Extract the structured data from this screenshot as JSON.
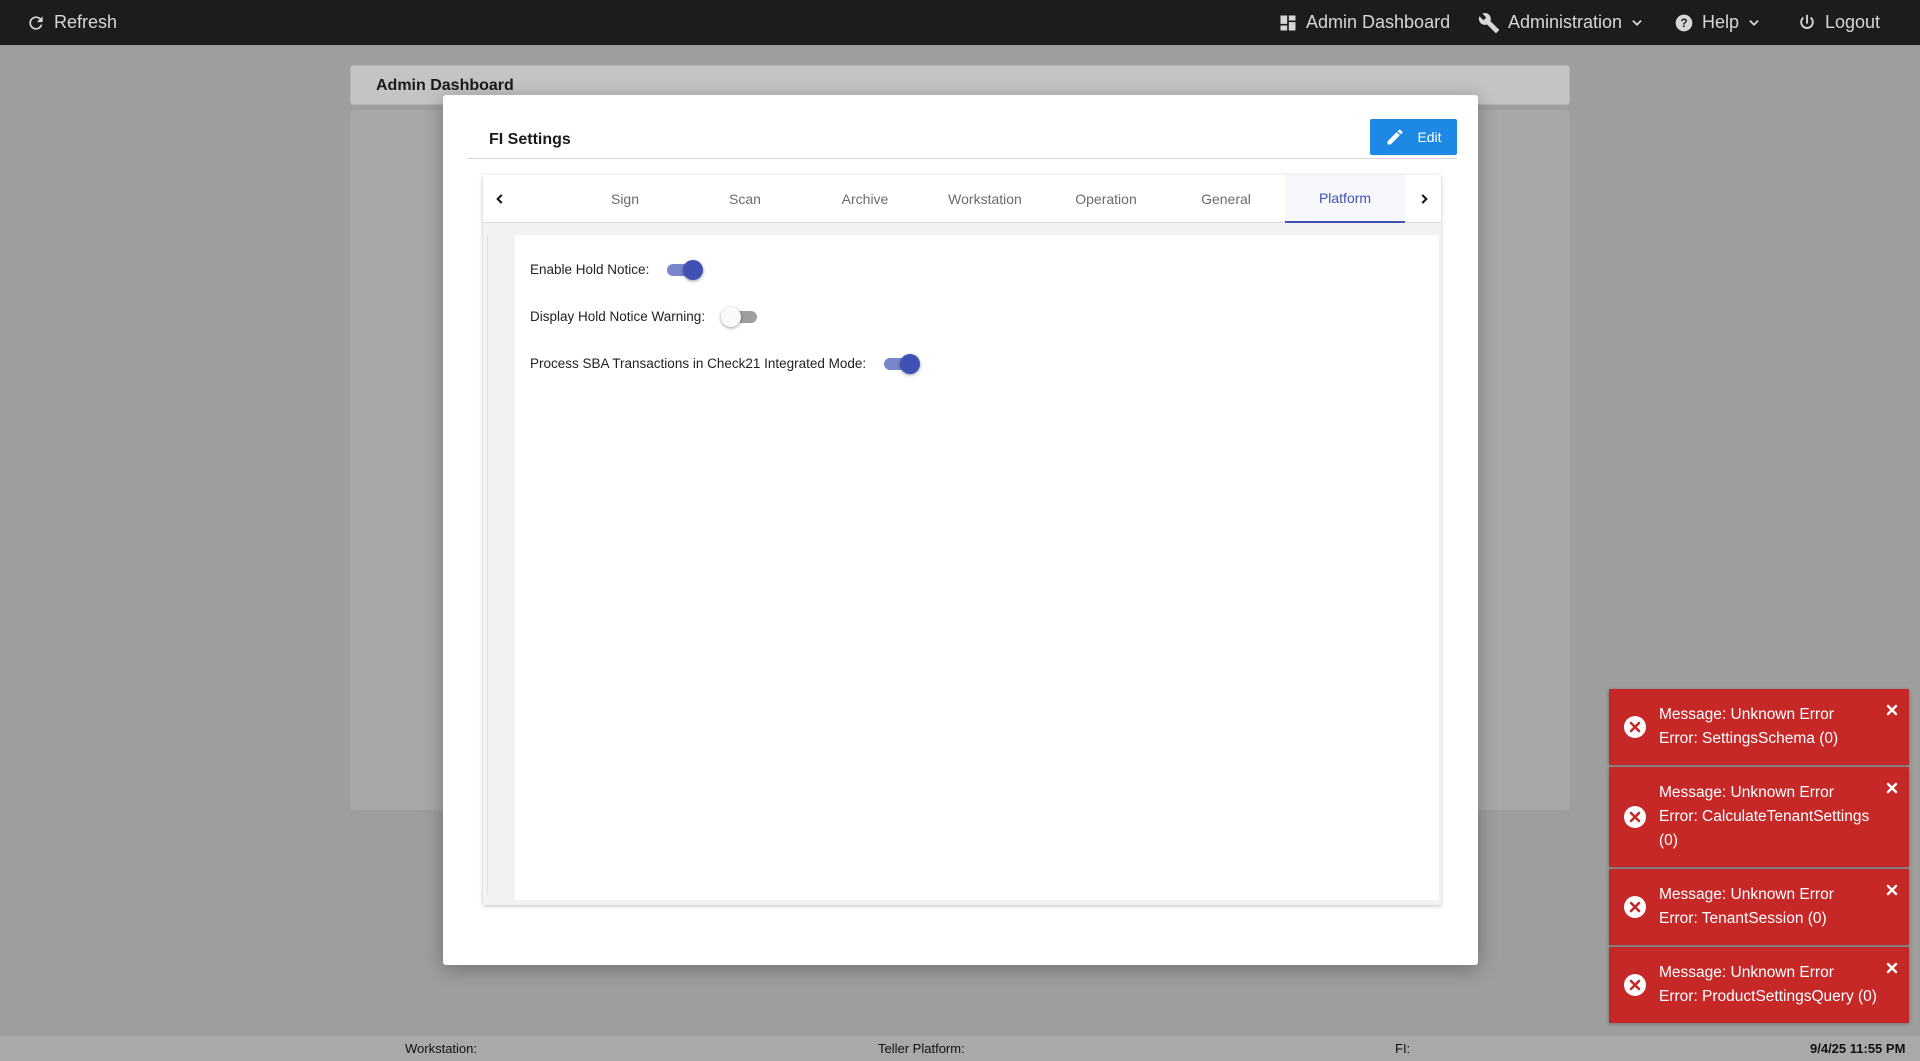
{
  "topbar": {
    "refresh_label": "Refresh",
    "nav": {
      "admin_dashboard": "Admin Dashboard",
      "administration": "Administration",
      "help": "Help",
      "logout": "Logout"
    },
    "colors": {
      "background": "#1c1c1c",
      "text": "#d6d6d6"
    }
  },
  "page": {
    "breadcrumb_title": "Admin Dashboard"
  },
  "modal": {
    "title": "FI Settings",
    "edit_label": "Edit",
    "tabs": [
      {
        "label": "Sign",
        "active": false
      },
      {
        "label": "Scan",
        "active": false
      },
      {
        "label": "Archive",
        "active": false
      },
      {
        "label": "Workstation",
        "active": false
      },
      {
        "label": "Operation",
        "active": false
      },
      {
        "label": "General",
        "active": false
      },
      {
        "label": "Platform",
        "active": true
      }
    ],
    "settings": [
      {
        "label": "Enable Hold Notice:",
        "enabled": true
      },
      {
        "label": "Display Hold Notice Warning:",
        "enabled": false
      },
      {
        "label": "Process SBA Transactions in Check21 Integrated Mode:",
        "enabled": true
      }
    ],
    "colors": {
      "accent": "#3f51b5",
      "edit_button": "#1e88e5"
    }
  },
  "toasts": [
    {
      "message": "Message: Unknown Error",
      "error": "Error: SettingsSchema (0)"
    },
    {
      "message": "Message: Unknown Error",
      "error": "Error: CalculateTenantSettings (0)"
    },
    {
      "message": "Message: Unknown Error",
      "error": "Error: TenantSession (0)"
    },
    {
      "message": "Message: Unknown Error",
      "error": "Error: ProductSettingsQuery (0)"
    }
  ],
  "toast_color": "#c62828",
  "footer": {
    "workstation_label": "Workstation:",
    "teller_platform_label": "Teller Platform:",
    "fi_label": "FI:",
    "datetime": "9/4/25 11:55 PM"
  }
}
